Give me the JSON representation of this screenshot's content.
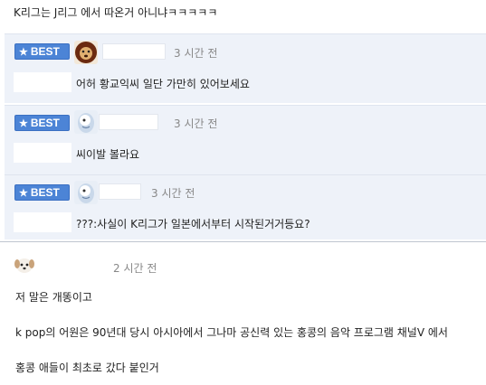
{
  "header_comment": "K리그는 J리그 에서 따온거 아니냐ㅋㅋㅋㅋㅋ",
  "best_label": "BEST",
  "best_comments": [
    {
      "time": "3 시간 전",
      "text": "어허 황교익씨 일단 가만히 있어보세요",
      "avatar": "lion-avatar"
    },
    {
      "time": "3 시간 전",
      "text": "씨이발 볼라요",
      "avatar": "cartoon-avatar"
    },
    {
      "time": "3 시간 전",
      "text": "???:사실이 K리그가 일본에서부터 시작된거거등요?",
      "avatar": "cartoon-avatar"
    }
  ],
  "last_comment": {
    "time": "2 시간 전",
    "avatar": "dog-avatar",
    "lines": [
      "저 말은 개똥이고",
      "k pop의 어원은 90년대 당시 아시아에서 그나마 공신력 있는 홍콩의 음악 프로그램 채널V 에서",
      "홍콩 애들이 최초로 갔다 붙인거"
    ]
  },
  "colors": {
    "best_badge": "#4c84d6",
    "best_background": "#eef2f9",
    "time_text": "#888888"
  }
}
